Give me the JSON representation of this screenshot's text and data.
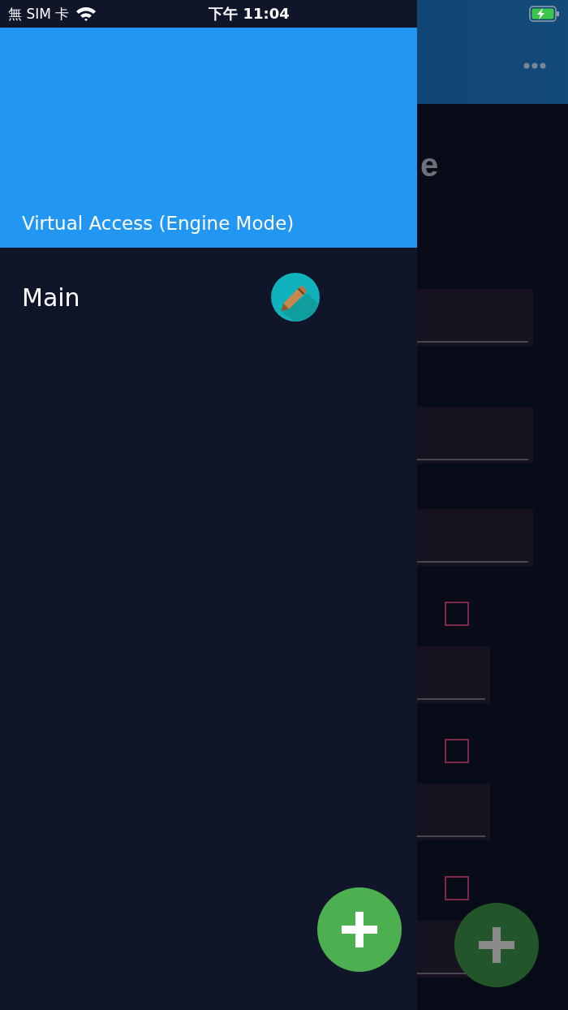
{
  "status_bar": {
    "carrier": "無 SIM 卡",
    "time": "下午 11:04",
    "charging": true
  },
  "drawer": {
    "title": "Virtual Access (Engine Mode)",
    "items": [
      {
        "label": "Main"
      }
    ]
  },
  "background": {
    "title": "e",
    "rows": [
      {
        "kind": "field"
      },
      {
        "kind": "field"
      },
      {
        "kind": "field"
      },
      {
        "kind": "checkbox",
        "checked": false
      },
      {
        "kind": "subfield"
      },
      {
        "kind": "checkbox",
        "checked": false
      },
      {
        "kind": "subfield"
      },
      {
        "kind": "checkbox",
        "checked": false
      },
      {
        "kind": "subfield"
      }
    ]
  }
}
